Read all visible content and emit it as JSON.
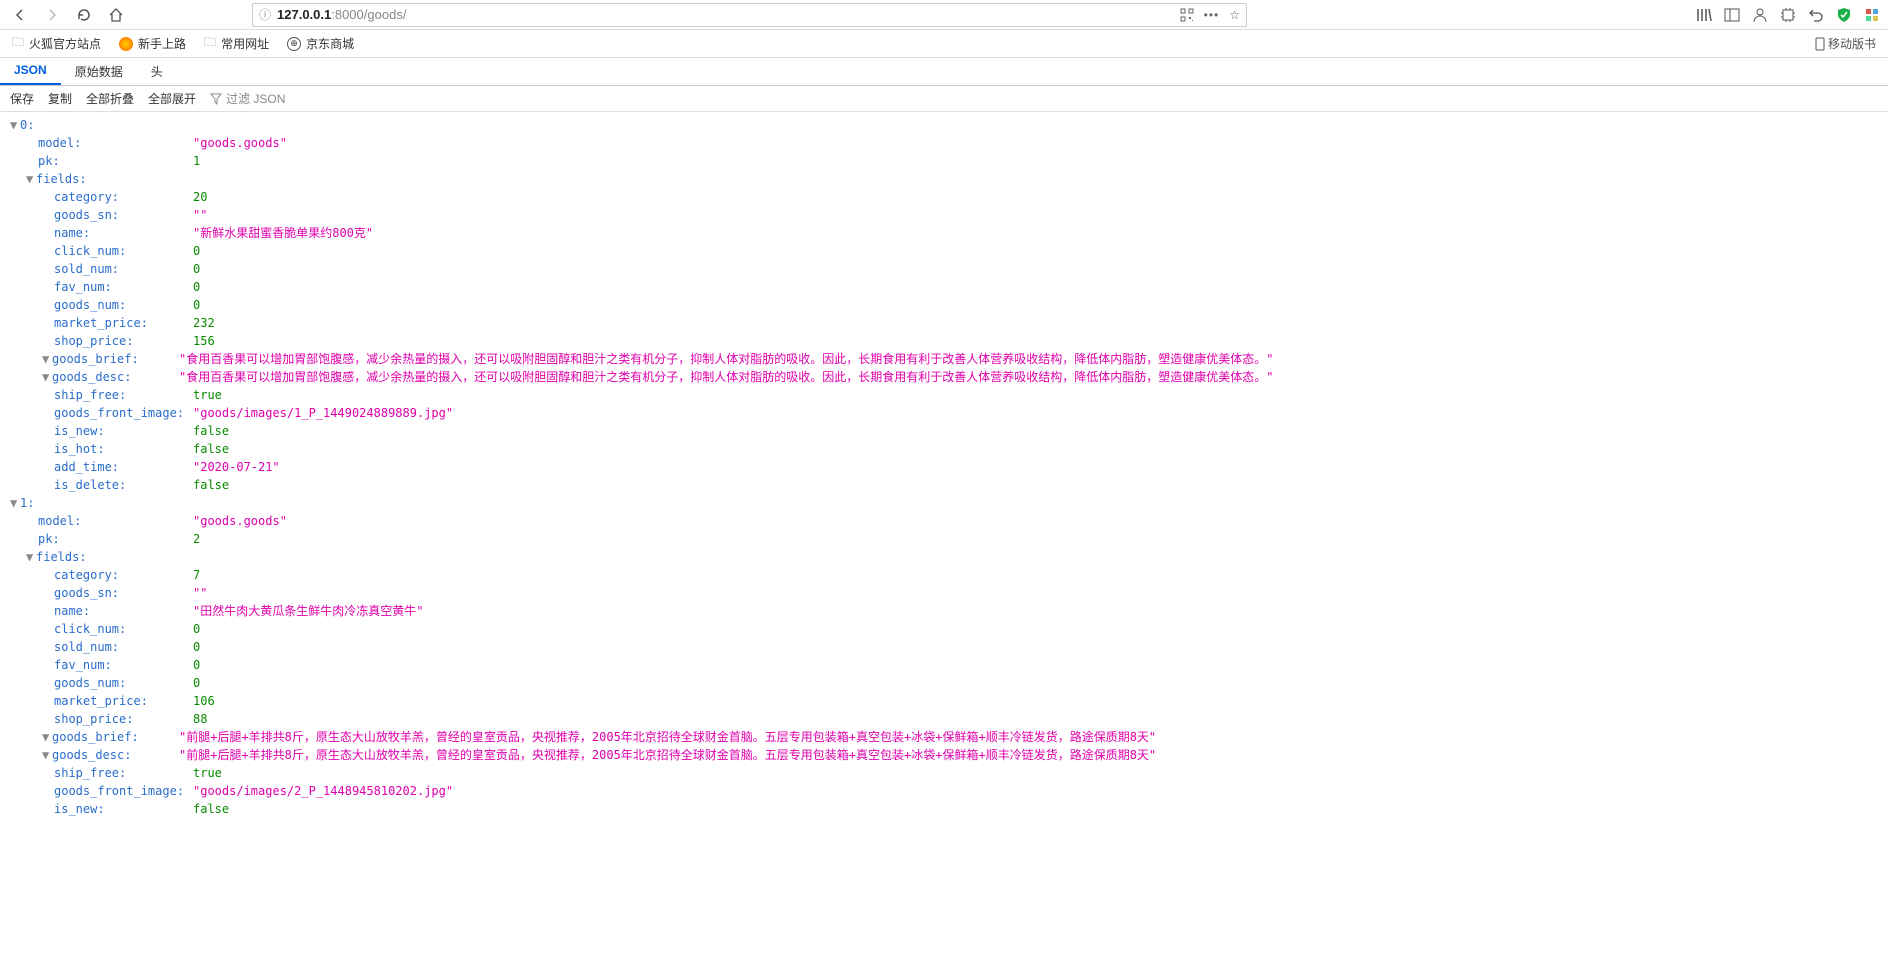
{
  "browser": {
    "url_host": "127.0.0.1",
    "url_port": ":8000",
    "url_path": "/goods/",
    "bookmarks": [
      "火狐官方站点",
      "新手上路",
      "常用网址",
      "京东商城"
    ],
    "mobile_label": "移动版书"
  },
  "jsonTabs": [
    "JSON",
    "原始数据",
    "头"
  ],
  "jsonActions": [
    "保存",
    "复制",
    "全部折叠",
    "全部展开"
  ],
  "filterPlaceholder": "过滤 JSON",
  "data": [
    {
      "idx": "0",
      "model": "\"goods.goods\"",
      "pk": "1",
      "fieldsLabel": "fields",
      "fields": [
        {
          "k": "category",
          "v": "20",
          "t": "num"
        },
        {
          "k": "goods_sn",
          "v": "\"\"",
          "t": "str"
        },
        {
          "k": "name",
          "v": "\"新鲜水果甜蜜香脆单果约800克\"",
          "t": "str"
        },
        {
          "k": "click_num",
          "v": "0",
          "t": "num"
        },
        {
          "k": "sold_num",
          "v": "0",
          "t": "num"
        },
        {
          "k": "fav_num",
          "v": "0",
          "t": "num"
        },
        {
          "k": "goods_num",
          "v": "0",
          "t": "num"
        },
        {
          "k": "market_price",
          "v": "232",
          "t": "num"
        },
        {
          "k": "shop_price",
          "v": "156",
          "t": "num"
        },
        {
          "k": "goods_brief",
          "v": "\"食用百香果可以增加胃部饱腹感，减少余热量的摄入，还可以吸附胆固醇和胆汁之类有机分子，抑制人体对脂肪的吸收。因此，长期食用有利于改善人体营养吸收结构，降低体内脂肪，塑造健康优美体态。\"",
          "t": "str",
          "tw": true
        },
        {
          "k": "goods_desc",
          "v": "\"食用百香果可以增加胃部饱腹感，减少余热量的摄入，还可以吸附胆固醇和胆汁之类有机分子，抑制人体对脂肪的吸收。因此，长期食用有利于改善人体营养吸收结构，降低体内脂肪，塑造健康优美体态。\"",
          "t": "str",
          "tw": true
        },
        {
          "k": "ship_free",
          "v": "true",
          "t": "bool"
        },
        {
          "k": "goods_front_image",
          "v": "\"goods/images/1_P_1449024889889.jpg\"",
          "t": "str"
        },
        {
          "k": "is_new",
          "v": "false",
          "t": "bool"
        },
        {
          "k": "is_hot",
          "v": "false",
          "t": "bool"
        },
        {
          "k": "add_time",
          "v": "\"2020-07-21\"",
          "t": "str"
        },
        {
          "k": "is_delete",
          "v": "false",
          "t": "bool"
        }
      ]
    },
    {
      "idx": "1",
      "model": "\"goods.goods\"",
      "pk": "2",
      "fieldsLabel": "fields",
      "fields": [
        {
          "k": "category",
          "v": "7",
          "t": "num"
        },
        {
          "k": "goods_sn",
          "v": "\"\"",
          "t": "str"
        },
        {
          "k": "name",
          "v": "\"田然牛肉大黄瓜条生鲜牛肉冷冻真空黄牛\"",
          "t": "str"
        },
        {
          "k": "click_num",
          "v": "0",
          "t": "num"
        },
        {
          "k": "sold_num",
          "v": "0",
          "t": "num"
        },
        {
          "k": "fav_num",
          "v": "0",
          "t": "num"
        },
        {
          "k": "goods_num",
          "v": "0",
          "t": "num"
        },
        {
          "k": "market_price",
          "v": "106",
          "t": "num"
        },
        {
          "k": "shop_price",
          "v": "88",
          "t": "num"
        },
        {
          "k": "goods_brief",
          "v": "\"前腿+后腿+羊排共8斤，原生态大山放牧羊羔，曾经的皇室贡品，央视推荐，2005年北京招待全球财金首脑。五层专用包装箱+真空包装+冰袋+保鲜箱+顺丰冷链发货，路途保质期8天\"",
          "t": "str",
          "tw": true
        },
        {
          "k": "goods_desc",
          "v": "\"前腿+后腿+羊排共8斤，原生态大山放牧羊羔，曾经的皇室贡品，央视推荐，2005年北京招待全球财金首脑。五层专用包装箱+真空包装+冰袋+保鲜箱+顺丰冷链发货，路途保质期8天\"",
          "t": "str",
          "tw": true
        },
        {
          "k": "ship_free",
          "v": "true",
          "t": "bool"
        },
        {
          "k": "goods_front_image",
          "v": "\"goods/images/2_P_1448945810202.jpg\"",
          "t": "str"
        },
        {
          "k": "is_new",
          "v": "false",
          "t": "bool"
        }
      ]
    }
  ]
}
